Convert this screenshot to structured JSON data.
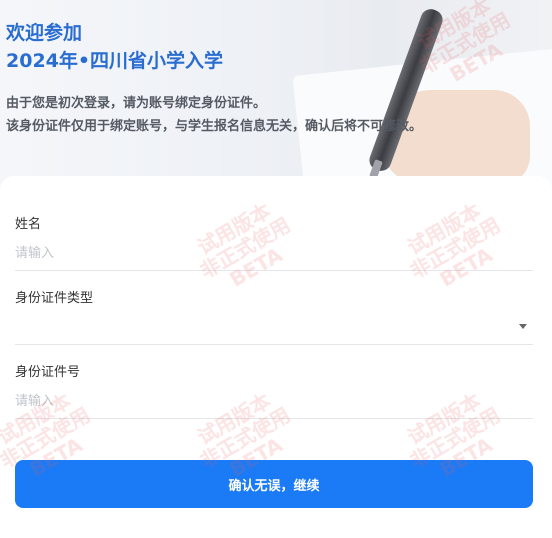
{
  "header": {
    "welcome": "欢迎参加",
    "title": "2024年•四川省小学入学",
    "notice_line1": "由于您是初次登录，请为账号绑定身份证件。",
    "notice_line2": "该身份证件仅用于绑定账号，与学生报名信息无关，确认后将不可修改。"
  },
  "form": {
    "name_label": "姓名",
    "name_placeholder": "请输入",
    "name_value": "",
    "id_type_label": "身份证件类型",
    "id_type_value": "",
    "id_number_label": "身份证件号",
    "id_number_placeholder": "请输入",
    "id_number_value": ""
  },
  "submit_label": "确认无误，继续",
  "watermark": {
    "line1": "试用版本",
    "line2": "非正式使用",
    "line3": "BETA"
  },
  "colors": {
    "primary": "#1b7bf6",
    "title": "#2a6dd1",
    "watermark": "#eb5a5a"
  },
  "icons": [
    "dropdown-caret-icon"
  ]
}
